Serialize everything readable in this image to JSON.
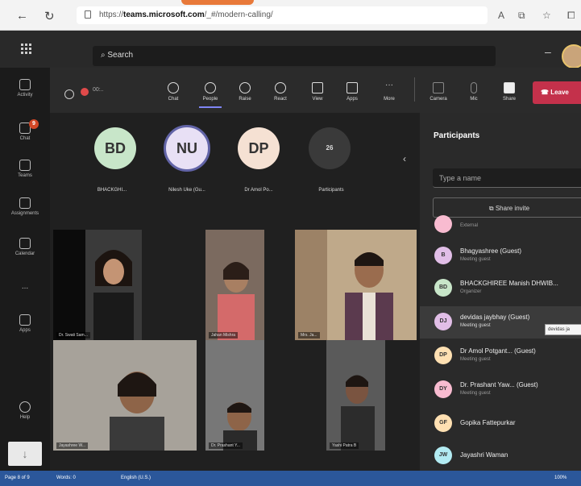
{
  "browser": {
    "url_prefix": "https://",
    "url_host": "teams.microsoft.com",
    "url_path": "/_#/modern-calling/"
  },
  "header": {
    "search_placeholder": "Search",
    "minimize": "–"
  },
  "left_rail": [
    {
      "label": "Activity"
    },
    {
      "label": "Chat",
      "badge": "9"
    },
    {
      "label": "Teams"
    },
    {
      "label": "Assignments"
    },
    {
      "label": "Calendar"
    },
    {
      "label": "..."
    },
    {
      "label": "Apps"
    },
    {
      "label": "Help"
    }
  ],
  "toolbar": {
    "timer": "00:..",
    "items": [
      {
        "label": "Chat"
      },
      {
        "label": "People",
        "active": true
      },
      {
        "label": "Raise"
      },
      {
        "label": "React"
      },
      {
        "label": "View"
      },
      {
        "label": "Apps"
      },
      {
        "label": "More"
      },
      {
        "label": "Camera"
      },
      {
        "label": "Mic"
      },
      {
        "label": "Share"
      }
    ],
    "leave_label": "Leave"
  },
  "avatars": [
    {
      "initials": "BD",
      "name": "BHACKGHI...",
      "color": "#c8e6c9"
    },
    {
      "initials": "NU",
      "name": "Nilesh Uke (Gu...",
      "color": "#e8e0f5",
      "ring": "#6264a7"
    },
    {
      "initials": "DP",
      "name": "Dr Amol Po...",
      "color": "#f5e1d3"
    },
    {
      "initials": "26",
      "name": "Participants",
      "color": "#3a3a3a"
    }
  ],
  "videos": [
    {
      "label": "Dr. Swati Sam..."
    },
    {
      "label": "Jahan Mishra"
    },
    {
      "label": "Mrs. Ja..."
    },
    {
      "label": "Jayashree W..."
    },
    {
      "label": "Dr. Prashant Y..."
    },
    {
      "label": "Yashi Patra B"
    }
  ],
  "panel": {
    "title": "Participants",
    "search_placeholder": "Type a name",
    "share_label": "Share invite",
    "participants": [
      {
        "initials": "",
        "name": "",
        "role": "External",
        "color": "#f8bbd0"
      },
      {
        "initials": "B",
        "name": "Bhagyashree (Guest)",
        "role": "Meeting guest",
        "color": "#e1bee7"
      },
      {
        "initials": "BD",
        "name": "BHACKGHIREE Manish DHWIB...",
        "role": "Organizer",
        "color": "#c8e6c9"
      },
      {
        "initials": "DJ",
        "name": "devidas jaybhay (Guest)",
        "role": "Meeting guest",
        "color": "#e1bee7"
      },
      {
        "initials": "DP",
        "name": "Dr Amol Potgant... (Guest)",
        "role": "Meeting guest",
        "color": "#ffe0b2"
      },
      {
        "initials": "DY",
        "name": "Dr. Prashant Yaw... (Guest)",
        "role": "Meeting guest",
        "color": "#f8bbd0"
      },
      {
        "initials": "GF",
        "name": "Gopika Fattepurkar",
        "role": "",
        "color": "#ffe0b2"
      },
      {
        "initials": "JW",
        "name": "Jayashri Waman",
        "role": "",
        "color": "#b2ebf2"
      }
    ],
    "tooltip": "devidas ja"
  },
  "status_bar": {
    "page": "Page 8 of 9",
    "words": "Words: 0",
    "lang": "English (U.S.)",
    "zoom": "100%"
  }
}
